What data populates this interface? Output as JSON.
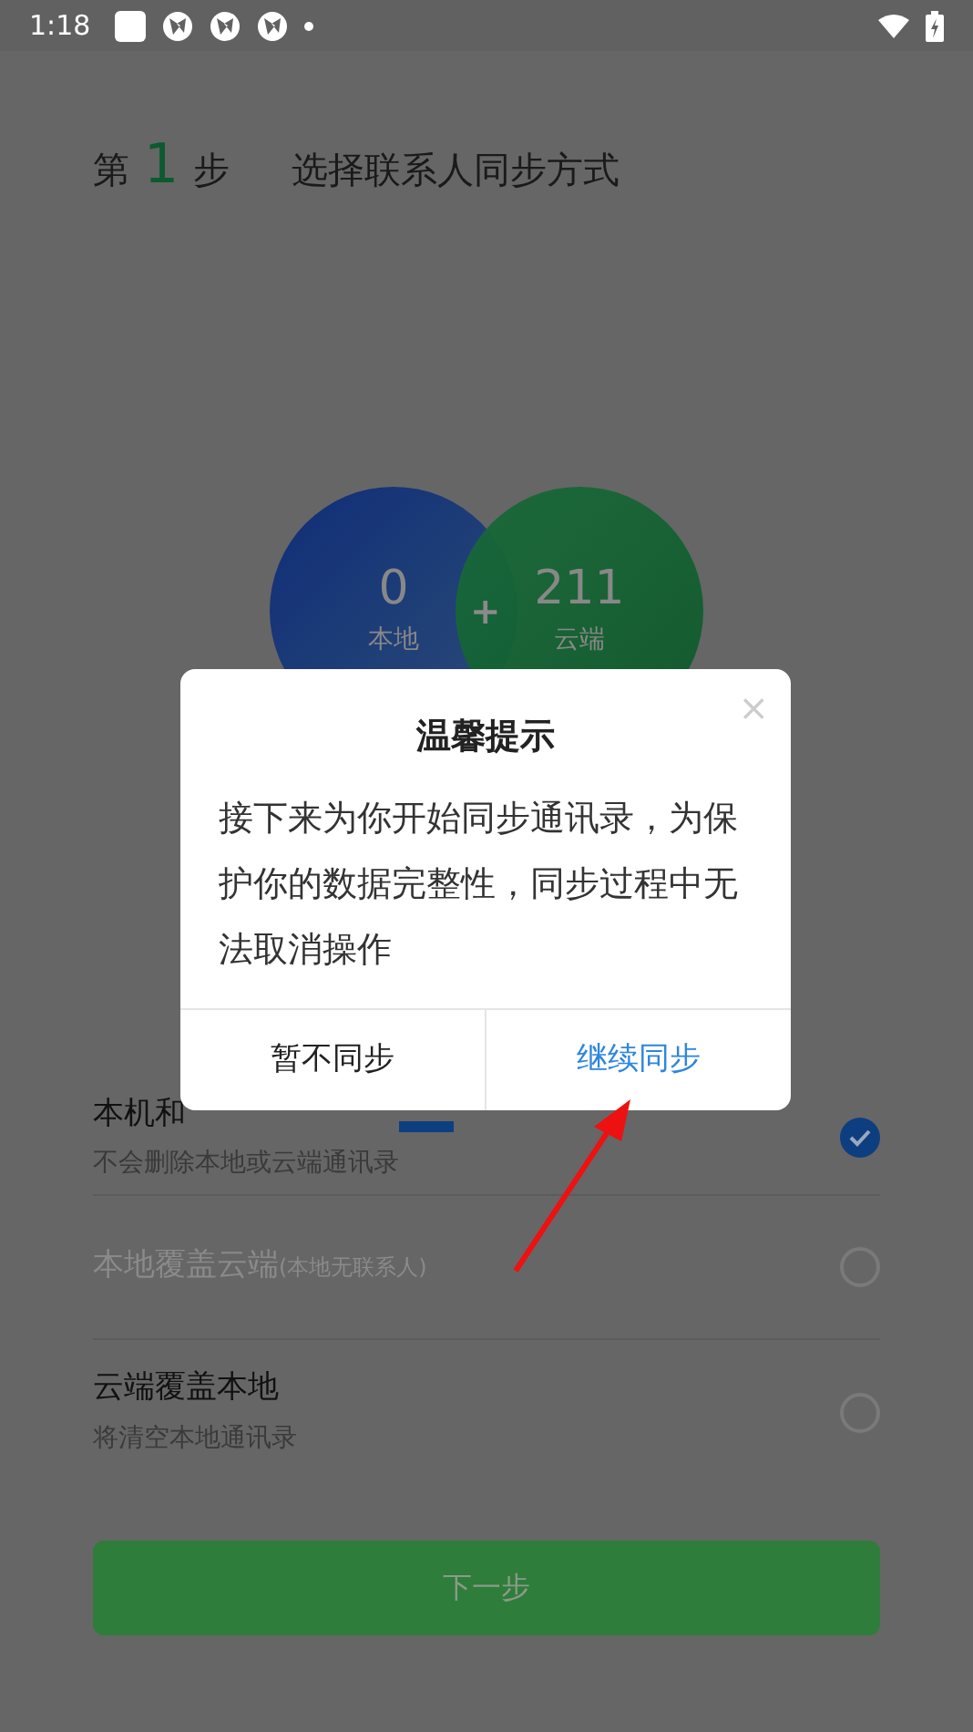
{
  "status_bar": {
    "time": "1:18"
  },
  "header": {
    "step_prefix": "第",
    "step_number": "1",
    "step_suffix": "步",
    "title": "选择联系人同步方式"
  },
  "contacts": [
    {
      "count": "0",
      "label": "本地"
    },
    {
      "count": "211",
      "label": "云端"
    }
  ],
  "merge_symbol": "+",
  "options": [
    {
      "title": "本机和",
      "subtitle": "不会删除本地或云端通讯录",
      "badge": true,
      "disabled": false,
      "selected": true
    },
    {
      "title": "本地覆盖云端",
      "note": "(本地无联系人)",
      "badge": false,
      "disabled": true,
      "selected": false
    },
    {
      "title": "云端覆盖本地",
      "subtitle": "将清空本地通讯录",
      "badge": false,
      "disabled": false,
      "selected": false
    }
  ],
  "next_button": {
    "label": "下一步"
  },
  "dialog": {
    "title": "温馨提示",
    "close": "×",
    "message": "接下来为你开始同步通讯录，为保护你的数据完整性，同步过程中无法取消操作",
    "buttons": [
      {
        "label": "暂不同步",
        "primary": false
      },
      {
        "label": "继续同步",
        "primary": true
      }
    ]
  },
  "annotation_arrow": true
}
